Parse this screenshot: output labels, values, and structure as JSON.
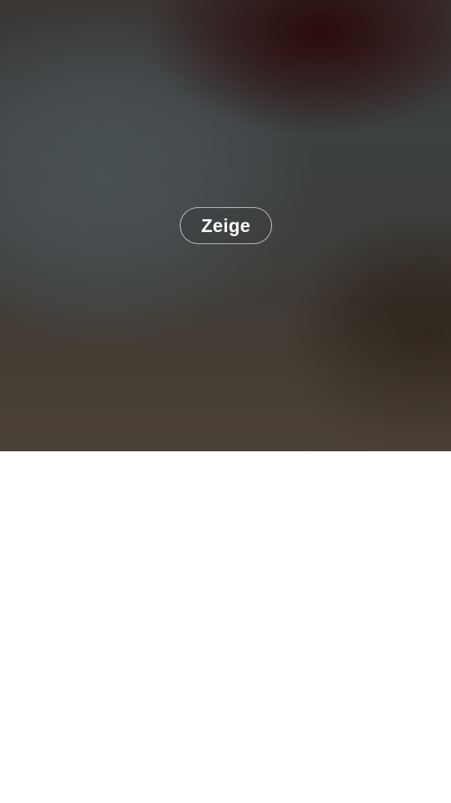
{
  "media": {
    "blurred": true,
    "show_button_label": "Zeige"
  }
}
